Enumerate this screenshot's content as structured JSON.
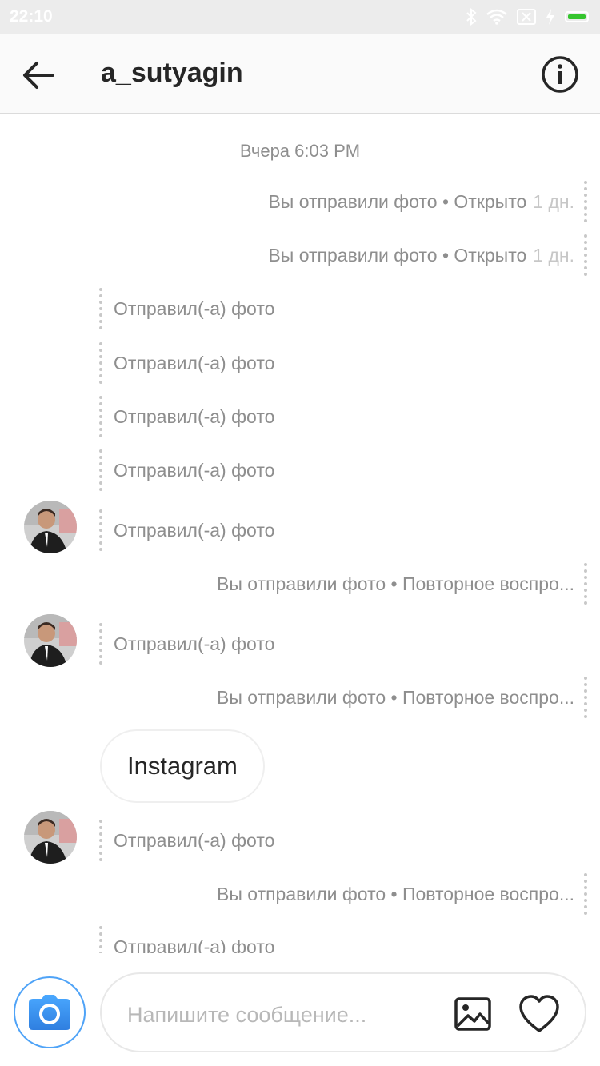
{
  "status_bar": {
    "time": "22:10",
    "battery_color": "#36c52f"
  },
  "header": {
    "username": "a_sutyagin",
    "back_icon": "back-arrow-icon",
    "info_icon": "info-icon"
  },
  "thread": {
    "timestamp": "Вчера 6:03 PM",
    "messages": [
      {
        "dir": "out",
        "text": "Вы отправили фото • Открыто",
        "age": "1 дн."
      },
      {
        "dir": "out",
        "text": "Вы отправили фото • Открыто",
        "age": "1 дн."
      },
      {
        "dir": "in",
        "text": "Отправил(-а) фото"
      },
      {
        "dir": "in",
        "text": "Отправил(-а) фото"
      },
      {
        "dir": "in",
        "text": "Отправил(-а) фото"
      },
      {
        "dir": "in",
        "text": "Отправил(-а) фото"
      },
      {
        "dir": "in",
        "text": "Отправил(-а) фото",
        "avatar": true
      },
      {
        "dir": "out",
        "text": "Вы отправили фото • Повторное воспро..."
      },
      {
        "dir": "in",
        "text": "Отправил(-а) фото",
        "avatar": true
      },
      {
        "dir": "out",
        "text": "Вы отправили фото • Повторное воспро..."
      },
      {
        "dir": "in",
        "text": "Отправил(-а) фото",
        "avatar": true
      },
      {
        "dir": "out",
        "text": "Вы отправили фото • Повторное воспро..."
      },
      {
        "dir": "in",
        "text": "Отправил(-а) фото"
      }
    ],
    "bubble_text": "Instagram"
  },
  "composer": {
    "placeholder": "Напишите сообщение...",
    "camera_icon": "camera-icon",
    "gallery_icon": "gallery-icon",
    "heart_icon": "heart-icon",
    "accent": "#3897f0"
  }
}
